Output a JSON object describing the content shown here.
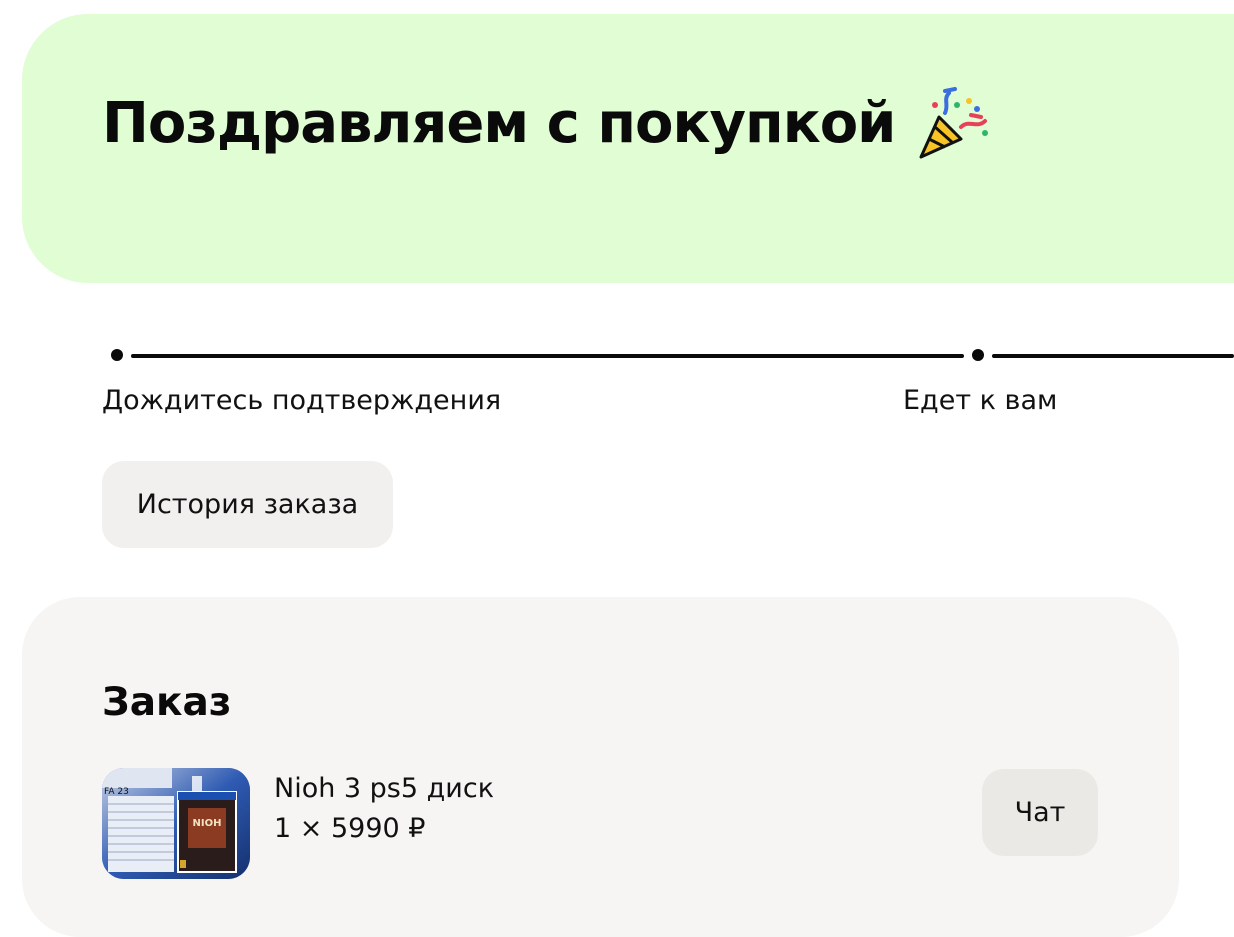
{
  "banner": {
    "title": "Поздравляем с покупкой",
    "icon": "party-popper-icon",
    "background_color": "#e0fdd3"
  },
  "progress": {
    "steps": [
      {
        "label": "Дождитесь подтверждения",
        "state": "current"
      },
      {
        "label": "Едет к вам",
        "state": "pending"
      }
    ]
  },
  "actions": {
    "history_label": "История заказа"
  },
  "order": {
    "title": "Заказ",
    "item": {
      "name": "Nioh 3 ps5 диск",
      "price_line": "1 × 5990 ₽",
      "quantity": 1,
      "price": 5990,
      "currency": "₽",
      "thumbnail": "product-photo"
    },
    "chat_label": "Чат"
  }
}
